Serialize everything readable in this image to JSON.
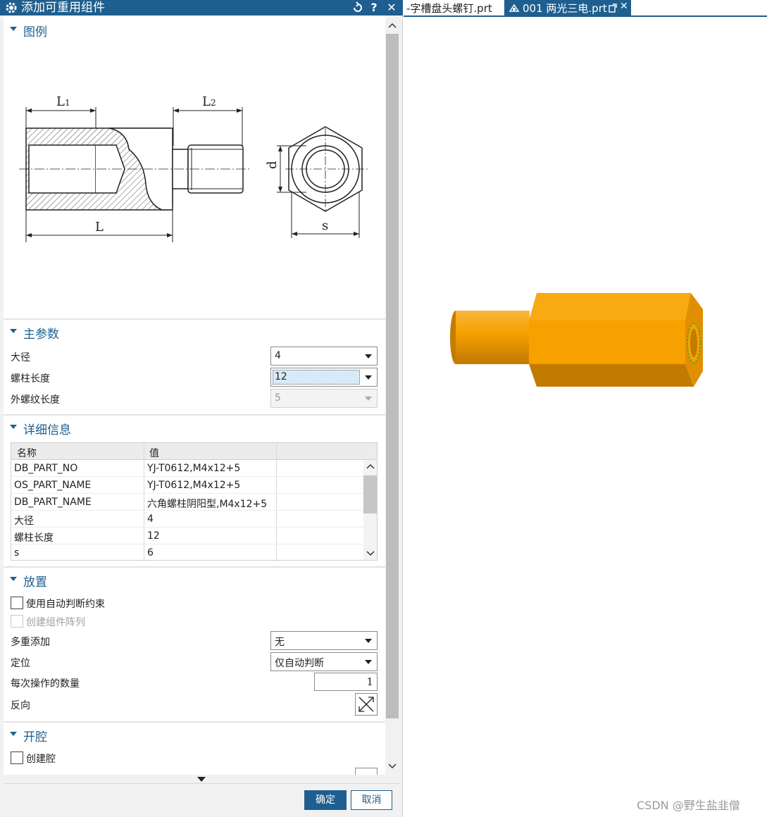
{
  "dialog": {
    "title": "添加可重用组件",
    "icons": [
      "gear-icon",
      "reset-icon",
      "help-icon",
      "close-icon"
    ],
    "help_label": "?",
    "close_label": "✕"
  },
  "sections": {
    "legend": "图例",
    "main_params": "主参数",
    "details": "详细信息",
    "placement": "放置",
    "cavity": "开腔"
  },
  "legend_drawing": {
    "dims": {
      "L1": "L",
      "L1_sub": "1",
      "L2": "L",
      "L2_sub": "2",
      "L": "L",
      "d": "d",
      "s": "s"
    }
  },
  "main_params": {
    "major_diameter": {
      "label": "大径",
      "value": "4"
    },
    "stud_length": {
      "label": "螺柱长度",
      "value": "12"
    },
    "ext_thread_length": {
      "label": "外螺纹长度",
      "value": "5"
    }
  },
  "details_table": {
    "columns": [
      "名称",
      "值"
    ],
    "rows": [
      {
        "name": "DB_PART_NO",
        "value": "YJ-T0612,M4x12+5"
      },
      {
        "name": "OS_PART_NAME",
        "value": "YJ-T0612,M4x12+5"
      },
      {
        "name": "DB_PART_NAME",
        "value": "六角螺柱阴阳型,M4x12+5"
      },
      {
        "name": "大径",
        "value": "4"
      },
      {
        "name": "螺柱长度",
        "value": "12"
      },
      {
        "name": "s",
        "value": "6"
      }
    ]
  },
  "placement": {
    "auto_constraint": {
      "label": "使用自动判断约束",
      "checked": false
    },
    "create_array": {
      "label": "创建组件阵列",
      "checked": false,
      "disabled": true
    },
    "multi_add": {
      "label": "多重添加",
      "value": "无"
    },
    "positioning": {
      "label": "定位",
      "value": "仅自动判断"
    },
    "count_per_op": {
      "label": "每次操作的数量",
      "value": "1"
    },
    "reverse": {
      "label": "反向"
    }
  },
  "cavity": {
    "create_cavity": {
      "label": "创建腔",
      "checked": false
    }
  },
  "buttons": {
    "ok": "确定",
    "cancel": "取消"
  },
  "tabs": [
    {
      "label": "-字槽盘头螺钉.prt",
      "active": false
    },
    {
      "label": "001 两光三电.prt",
      "active": true
    }
  ],
  "tab_icons": [
    "part-icon",
    "popout-icon",
    "close-icon"
  ],
  "tab_close_label": "✕",
  "model_colors": {
    "body": "#f7a100",
    "shade": "#c97d00",
    "dark": "#a86700"
  },
  "watermark": "CSDN @野生盐韭僧"
}
